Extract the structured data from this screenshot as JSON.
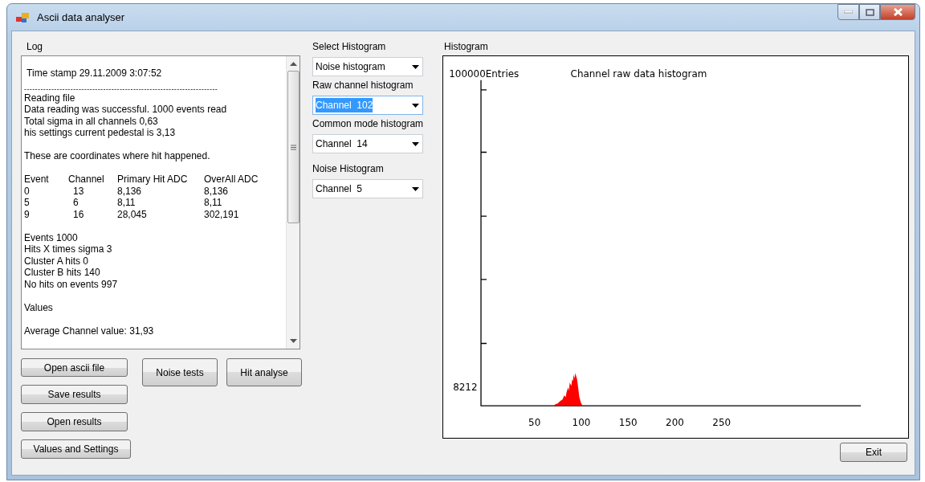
{
  "window": {
    "title": "Ascii data analyser"
  },
  "log": {
    "label": "Log",
    "lines": [
      {
        "kind": "line",
        "text": " Time stamp 29.11.2009 3:07:52"
      },
      {
        "kind": "rule",
        "text": "-----------------------------------------------------------------------"
      },
      {
        "kind": "line",
        "text": "Reading file"
      },
      {
        "kind": "line",
        "text": "Data reading was successful. 1000 events read"
      },
      {
        "kind": "line",
        "text": "Total sigma in all channels 0,63"
      },
      {
        "kind": "line",
        "text": "his settings current pedestal is 3,13"
      },
      {
        "kind": "gap"
      },
      {
        "kind": "line",
        "text": "These are coordinates where hit happened."
      },
      {
        "kind": "gap"
      },
      {
        "kind": "table",
        "columns": [
          "Event",
          "Channel",
          "Primary Hit ADC",
          "OverAll ADC"
        ],
        "rows": [
          [
            "0",
            "13",
            "8,136",
            "8,136"
          ],
          [
            "5",
            "6",
            "8,11",
            "8,11"
          ],
          [
            "9",
            "16",
            "28,045",
            "302,191"
          ]
        ]
      },
      {
        "kind": "gap"
      },
      {
        "kind": "line",
        "text": "Events 1000"
      },
      {
        "kind": "line",
        "text": "Hits X times sigma 3"
      },
      {
        "kind": "line",
        "text": "Cluster A hits 0"
      },
      {
        "kind": "line",
        "text": "Cluster B hits 140"
      },
      {
        "kind": "line",
        "text": "No hits on events 997"
      },
      {
        "kind": "gap"
      },
      {
        "kind": "line",
        "text": "Values"
      },
      {
        "kind": "gap"
      },
      {
        "kind": "line",
        "text": "Average Channel value: 31,93"
      }
    ]
  },
  "left_buttons": [
    "Open ascii file",
    "Save results",
    "Open results",
    "Values and Settings"
  ],
  "action_buttons": [
    "Noise tests",
    "Hit analyse"
  ],
  "selectors": [
    {
      "label": "Select Histogram",
      "value": "Noise histogram",
      "focused": false
    },
    {
      "label": "Raw channel  histogram",
      "value": "Channel  102",
      "focused": true
    },
    {
      "label": "Common mode histogram",
      "value": "Channel  14",
      "focused": false
    },
    {
      "label": "Noise Histogram",
      "value": "Channel  5",
      "focused": false
    }
  ],
  "histogram": {
    "label": "Histogram",
    "y_top_label": "100000Entries",
    "title": "Channel raw data histogram",
    "y_bottom_label": "8212",
    "x_labels": [
      "50",
      "100",
      "150",
      "200",
      "250"
    ]
  },
  "exit_button": "Exit"
}
